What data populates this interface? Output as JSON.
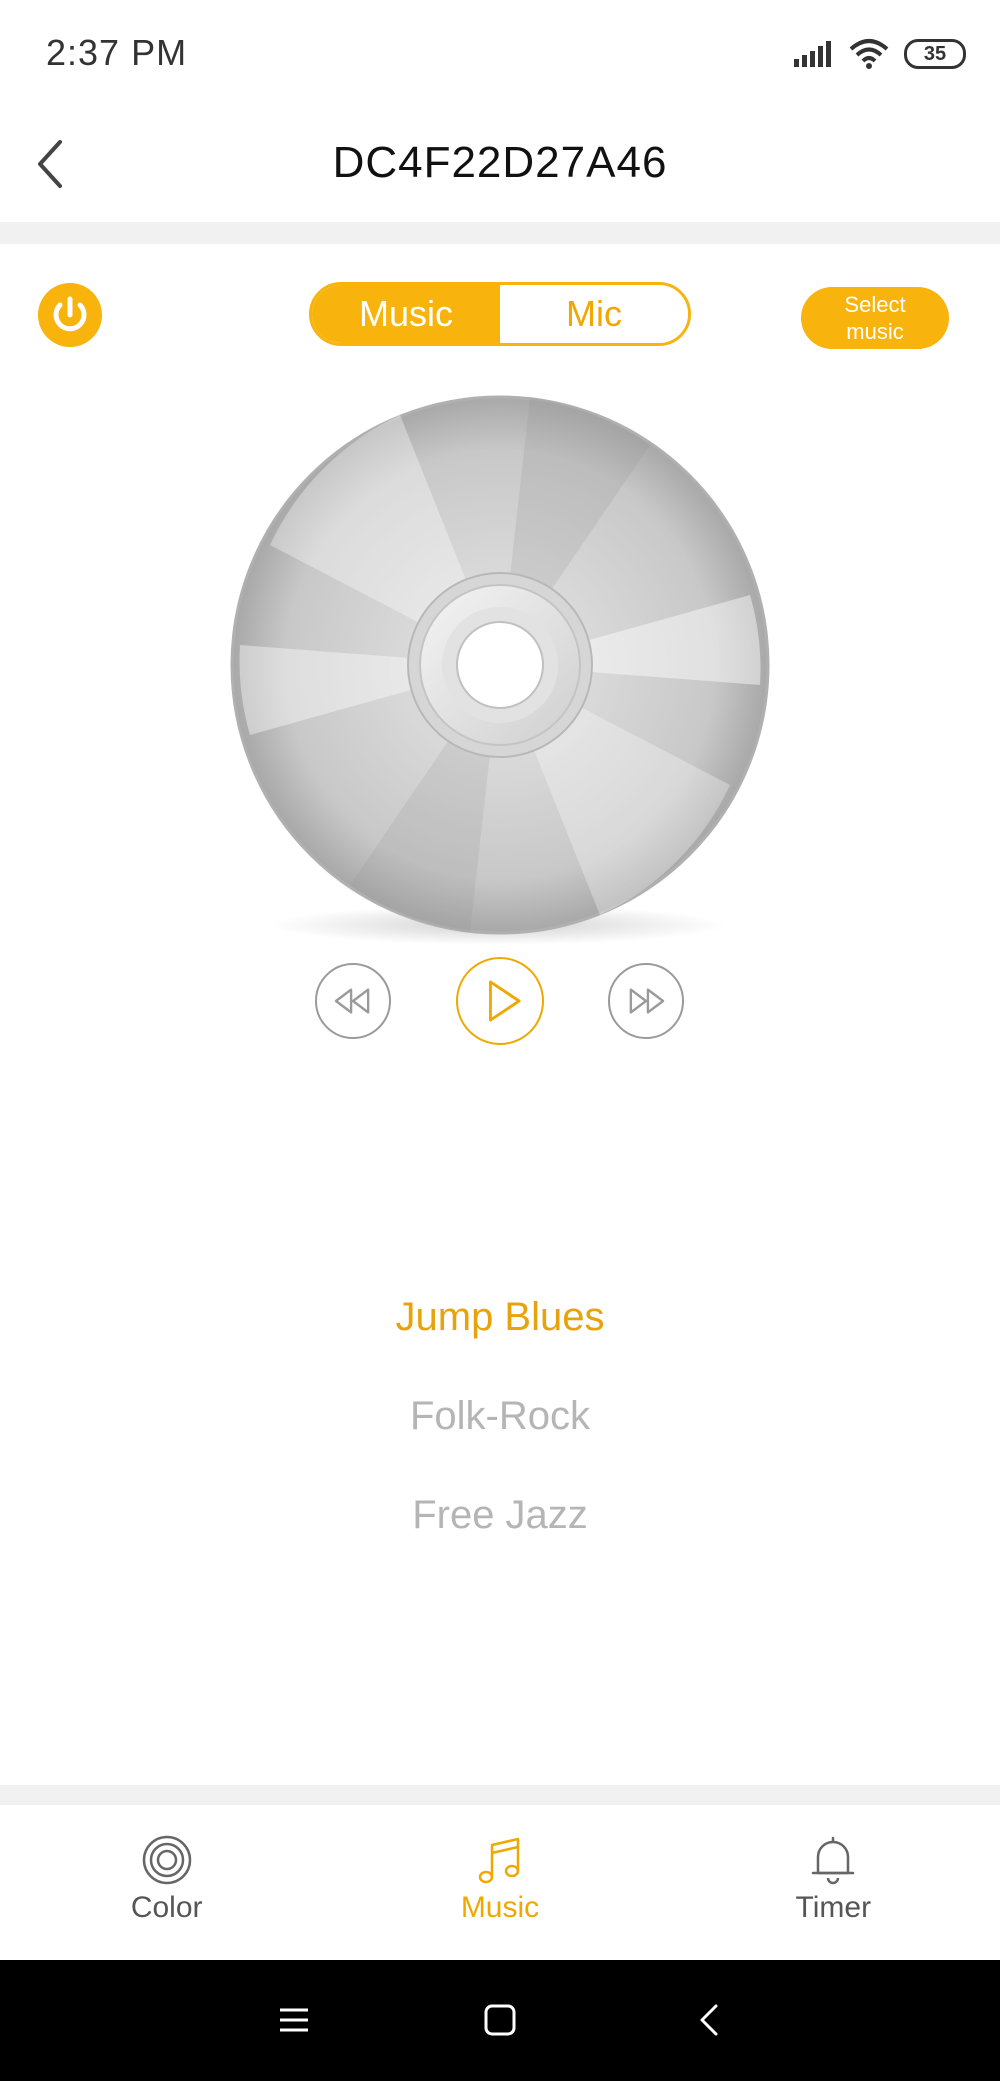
{
  "status_bar": {
    "time": "2:37 PM",
    "battery": "35"
  },
  "header": {
    "title": "DC4F22D27A46"
  },
  "controls": {
    "mode_tabs": [
      "Music",
      "Mic"
    ],
    "active_mode": "Music",
    "select_music_line1": "Select",
    "select_music_line2": "music"
  },
  "playlist": {
    "songs": [
      "Jump Blues",
      "Folk-Rock",
      "Free Jazz"
    ],
    "current": "Jump Blues"
  },
  "tabs": [
    {
      "label": "Color",
      "icon": "color-rings-icon"
    },
    {
      "label": "Music",
      "icon": "music-note-icon"
    },
    {
      "label": "Timer",
      "icon": "bell-icon"
    }
  ],
  "active_tab": "Music",
  "colors": {
    "accent": "#f8b30c",
    "accent_text": "#f0a800",
    "inactive_text": "#b5b5b5",
    "divider": "#f1f1f1",
    "system_nav": "#000000"
  }
}
